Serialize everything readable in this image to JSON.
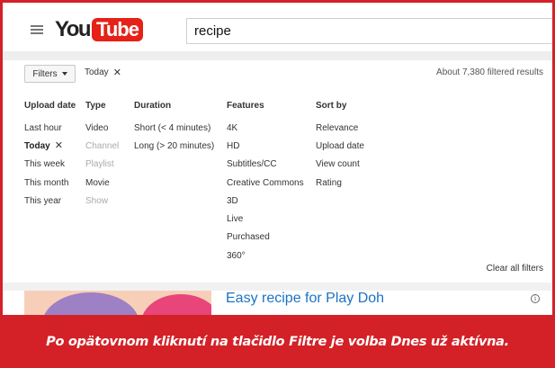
{
  "header": {
    "logo_you": "You",
    "logo_tube": "Tube",
    "search_value": "recipe"
  },
  "filterbar": {
    "filters_label": "Filters",
    "active_filter": "Today",
    "results_text": "About 7,380 filtered results"
  },
  "columns": [
    {
      "heading": "Upload date",
      "items": [
        {
          "label": "Last hour",
          "state": "normal"
        },
        {
          "label": "Today",
          "state": "selected"
        },
        {
          "label": "This week",
          "state": "normal"
        },
        {
          "label": "This month",
          "state": "normal"
        },
        {
          "label": "This year",
          "state": "normal"
        }
      ]
    },
    {
      "heading": "Type",
      "items": [
        {
          "label": "Video",
          "state": "normal"
        },
        {
          "label": "Channel",
          "state": "disabled"
        },
        {
          "label": "Playlist",
          "state": "disabled"
        },
        {
          "label": "Movie",
          "state": "normal"
        },
        {
          "label": "Show",
          "state": "disabled"
        }
      ]
    },
    {
      "heading": "Duration",
      "items": [
        {
          "label": "Short (< 4 minutes)",
          "state": "normal"
        },
        {
          "label": "Long (> 20 minutes)",
          "state": "normal"
        }
      ]
    },
    {
      "heading": "Features",
      "items": [
        {
          "label": "4K",
          "state": "normal"
        },
        {
          "label": "HD",
          "state": "normal"
        },
        {
          "label": "Subtitles/CC",
          "state": "normal"
        },
        {
          "label": "Creative Commons",
          "state": "normal"
        },
        {
          "label": "3D",
          "state": "normal"
        },
        {
          "label": "Live",
          "state": "normal"
        },
        {
          "label": "Purchased",
          "state": "normal"
        },
        {
          "label": "360°",
          "state": "normal"
        }
      ]
    },
    {
      "heading": "Sort by",
      "items": [
        {
          "label": "Relevance",
          "state": "normal"
        },
        {
          "label": "Upload date",
          "state": "normal"
        },
        {
          "label": "View count",
          "state": "normal"
        },
        {
          "label": "Rating",
          "state": "normal"
        }
      ]
    }
  ],
  "clear_all_label": "Clear all filters",
  "video": {
    "title": "Easy recipe for Play Doh"
  },
  "caption": "Po opätovnom kliknutí na tlačidlo Filtre je volba Dnes už aktívna.",
  "colors": {
    "accent_red": "#d32127",
    "youtube_red": "#e62117",
    "link_blue": "#1a73c5"
  }
}
